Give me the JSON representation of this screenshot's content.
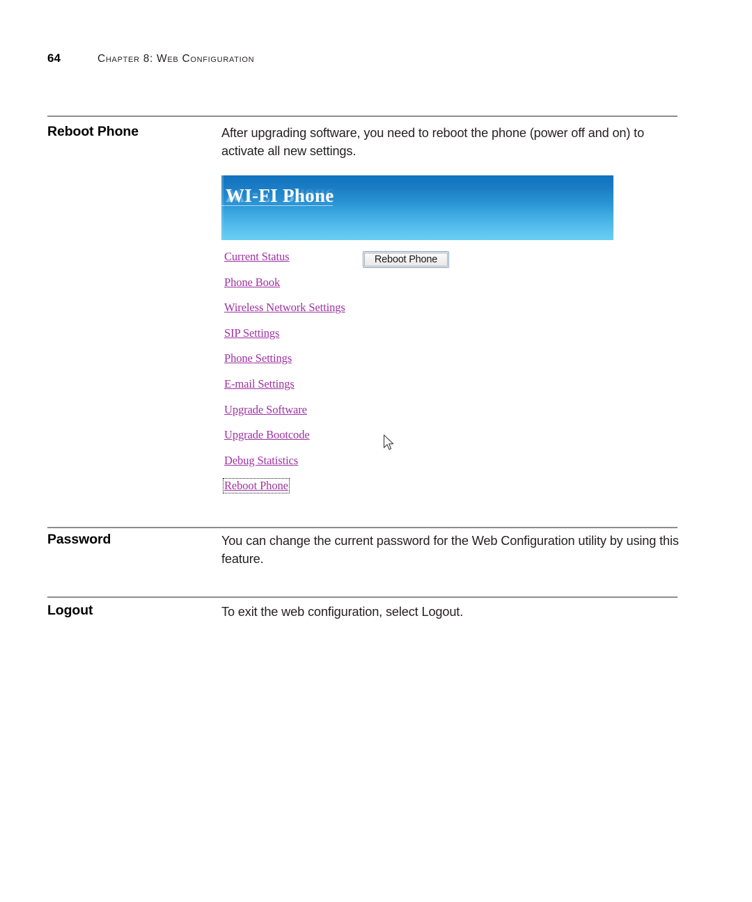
{
  "page": {
    "folio": "64",
    "chapter_title": "Chapter 8: Web Configuration"
  },
  "sections": [
    {
      "term": "Reboot Phone",
      "body": "After upgrading software, you need to reboot the phone (power off and on) to activate all new settings."
    },
    {
      "term": "Password",
      "body": "You can change the current password for the Web Configuration utility by using this feature."
    },
    {
      "term": "Logout",
      "body": "To exit the web configuration, select Logout."
    }
  ],
  "screenshot": {
    "banner": {
      "title": "WI-FI Phone",
      "gradient_top": "#0f72bf",
      "gradient_bottom": "#6bcdf2"
    },
    "nav": {
      "link_color": "#9f31a3",
      "items": [
        {
          "label": "Current Status",
          "focused": false
        },
        {
          "label": "Phone Book",
          "focused": false
        },
        {
          "label": "Wireless Network Settings",
          "focused": false
        },
        {
          "label": "SIP Settings",
          "focused": false
        },
        {
          "label": "Phone Settings",
          "focused": false
        },
        {
          "label": "E-mail Settings",
          "focused": false
        },
        {
          "label": "Upgrade Software",
          "focused": false
        },
        {
          "label": "Upgrade Bootcode",
          "focused": false
        },
        {
          "label": "Debug Statistics",
          "focused": false
        },
        {
          "label": "Reboot Phone",
          "focused": true
        }
      ]
    },
    "reboot_button": {
      "label": "Reboot Phone",
      "border_color": "#7d9cbe"
    },
    "cursor": {
      "icon": "mouse-pointer-icon"
    }
  }
}
